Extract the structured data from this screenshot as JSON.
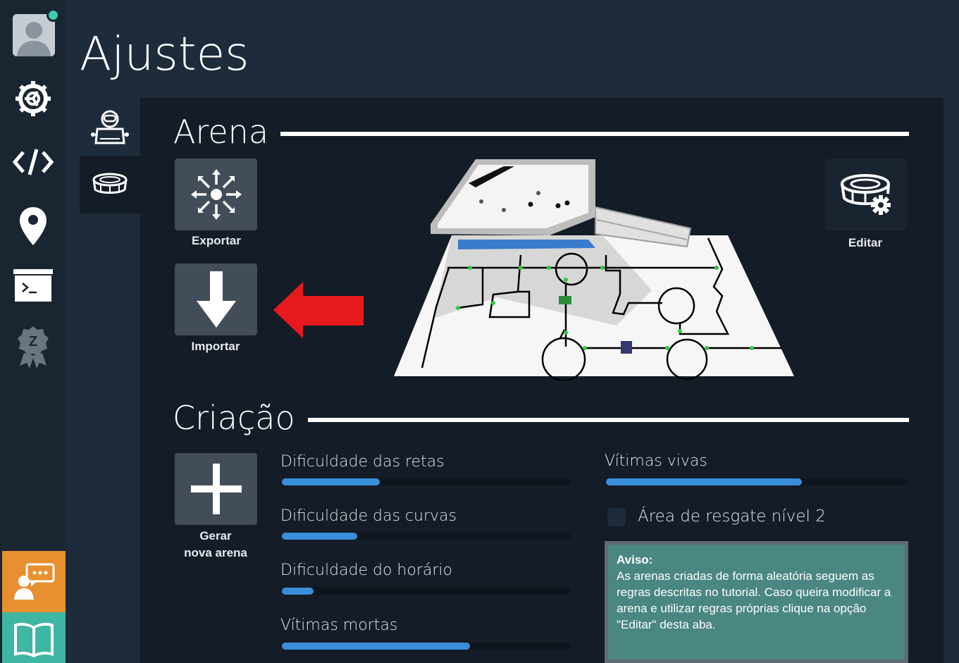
{
  "page": {
    "title": "Ajustes"
  },
  "sidebar": {
    "items": [
      {
        "name": "avatar",
        "icon": "user-avatar-icon"
      },
      {
        "name": "settings",
        "icon": "gear-icon"
      },
      {
        "name": "code",
        "icon": "code-icon"
      },
      {
        "name": "location",
        "icon": "map-pin-icon"
      },
      {
        "name": "terminal",
        "icon": "terminal-icon"
      },
      {
        "name": "badge",
        "icon": "award-badge-icon"
      },
      {
        "name": "support",
        "icon": "chat-support-icon"
      },
      {
        "name": "tutorial",
        "icon": "book-icon"
      }
    ],
    "badge_letter": "Z",
    "colors": {
      "orange": "#e8902f",
      "teal": "#3fb5a3",
      "online": "#3ecbb0"
    }
  },
  "tabs": [
    {
      "name": "robot",
      "icon": "robot-icon"
    },
    {
      "name": "arena",
      "icon": "stadium-icon",
      "active": true
    }
  ],
  "arena": {
    "title": "Arena",
    "export_label": "Exportar",
    "import_label": "Importar",
    "edit_label": "Editar"
  },
  "creation": {
    "title": "Criação",
    "generate_label_line1": "Gerar",
    "generate_label_line2": "nova arena",
    "sliders": [
      {
        "label": "Dificuldade das retas",
        "value": 0.34
      },
      {
        "label": "Dificuldade das curvas",
        "value": 0.26
      },
      {
        "label": "Dificuldade do horário",
        "value": 0.11
      },
      {
        "label": "Vítimas mortas",
        "value": 0.65
      },
      {
        "label": "Vítimas vivas",
        "value": 0.65
      }
    ],
    "rescue_checkbox_label": "Área de resgate nível 2",
    "rescue_checked": false,
    "notice_title": "Aviso:",
    "notice_text": "As arenas criadas de forma aleatória seguem as regras descritas no tutorial. Caso queira modificar a arena e utilizar regras próprias clique na opção \"Editar\" desta aba."
  }
}
